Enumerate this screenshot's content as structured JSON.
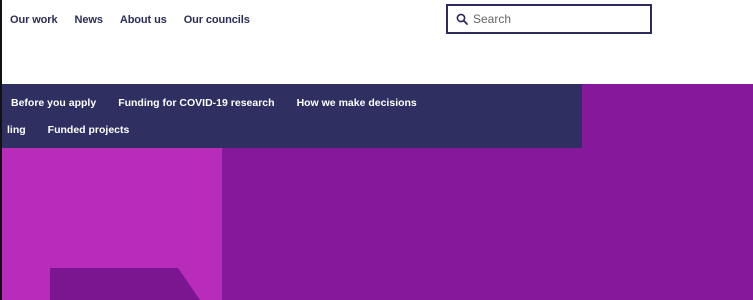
{
  "top_nav": {
    "items": [
      "Our work",
      "News",
      "About us",
      "Our councils"
    ]
  },
  "search": {
    "placeholder": "Search",
    "icon": "search-icon"
  },
  "sub_nav": {
    "row1": [
      "Before you apply",
      "Funding for COVID-19 research",
      "How we make decisions"
    ],
    "row2": [
      "ling",
      "Funded projects"
    ]
  },
  "colors": {
    "nav_text": "#2b2d5a",
    "sub_nav_bg": "#2f2f62",
    "hero_purple": "#86199b",
    "hero_magenta": "#b82cbc",
    "hero_shape": "#7a1790"
  }
}
